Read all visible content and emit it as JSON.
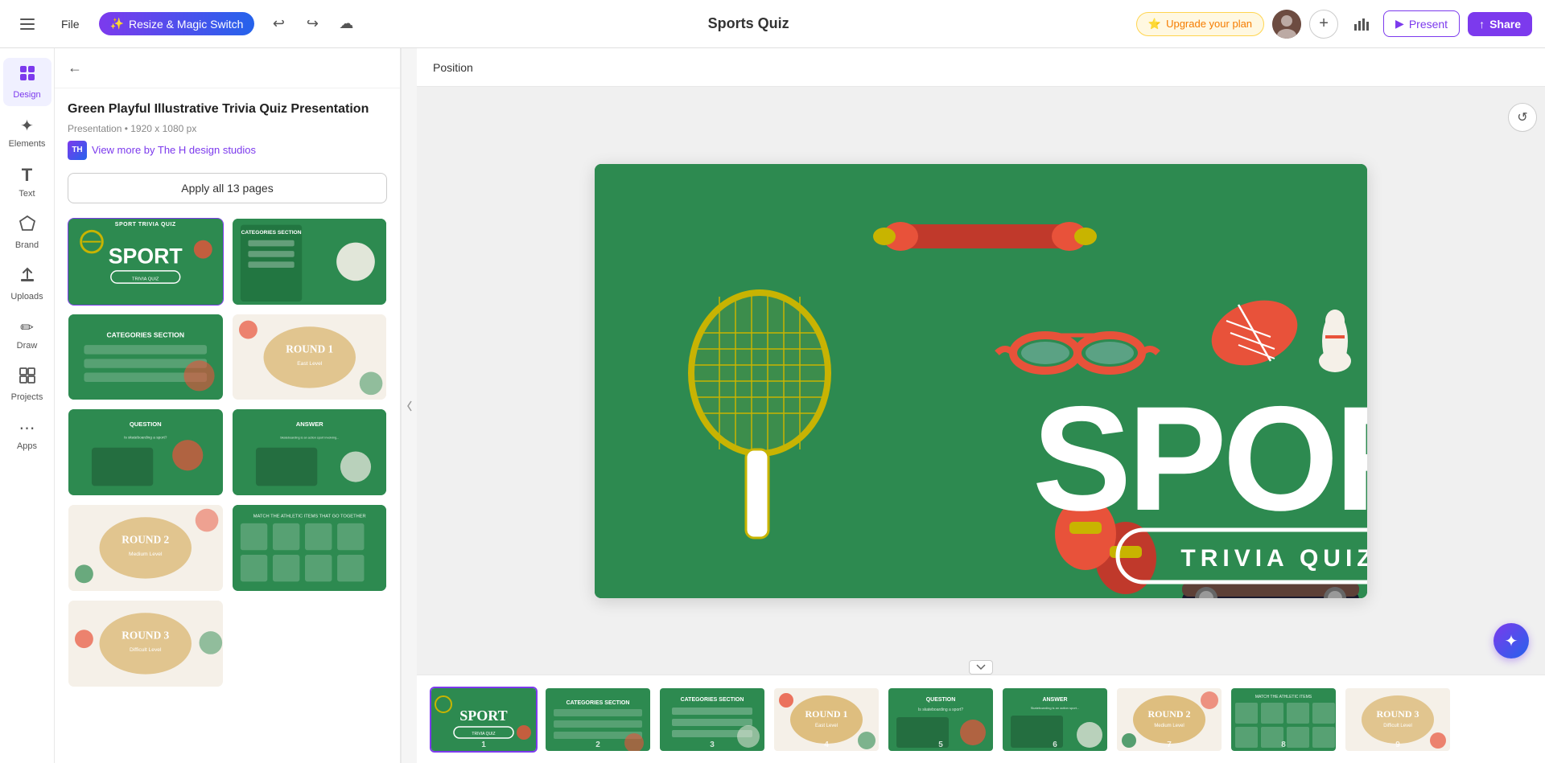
{
  "navbar": {
    "file_label": "File",
    "magic_switch_label": "Resize & Magic Switch",
    "doc_title": "Sports Quiz",
    "upgrade_label": "Upgrade your plan",
    "add_btn_label": "+",
    "present_label": "Present",
    "share_label": "Share"
  },
  "sidebar": {
    "items": [
      {
        "id": "design",
        "label": "Design",
        "icon": "⊞",
        "active": true
      },
      {
        "id": "elements",
        "label": "Elements",
        "icon": "✦"
      },
      {
        "id": "text",
        "label": "Text",
        "icon": "T"
      },
      {
        "id": "brand",
        "label": "Brand",
        "icon": "◈"
      },
      {
        "id": "uploads",
        "label": "Uploads",
        "icon": "↑"
      },
      {
        "id": "draw",
        "label": "Draw",
        "icon": "✏"
      },
      {
        "id": "projects",
        "label": "Projects",
        "icon": "▦"
      },
      {
        "id": "apps",
        "label": "Apps",
        "icon": "⋯"
      }
    ]
  },
  "panel": {
    "back_label": "←",
    "title": "Green Playful Illustrative Trivia Quiz Presentation",
    "meta": "Presentation • 1920 x 1080 px",
    "author_initials": "TH",
    "author_link": "View more by The H design studios",
    "apply_btn": "Apply all 13 pages",
    "position_label": "Position"
  },
  "thumbnails": [
    {
      "id": 1,
      "type": "sport",
      "label": "SPORT TRIVIA QUIZ",
      "bg": "#2d8a50"
    },
    {
      "id": 2,
      "type": "categories",
      "label": "CATEGORIES SECTION",
      "bg": "#2d8a50"
    },
    {
      "id": 3,
      "type": "categories2",
      "label": "CATEGORIES SECTION",
      "bg": "#2d8a50"
    },
    {
      "id": 4,
      "type": "round1",
      "label": "ROUND 1 EASY LEVEL",
      "bg": "#f5f0e8"
    },
    {
      "id": 5,
      "type": "question",
      "label": "QUESTION",
      "bg": "#2d8a50"
    },
    {
      "id": 6,
      "type": "answer",
      "label": "ANSWER",
      "bg": "#2d8a50"
    },
    {
      "id": 7,
      "type": "round2",
      "label": "ROUND 2 MEDIUM LEVEL",
      "bg": "#f5f0e8"
    },
    {
      "id": 8,
      "type": "match",
      "label": "MATCH THE ITEMS",
      "bg": "#2d8a50"
    },
    {
      "id": 9,
      "type": "round3",
      "label": "ROUND 3 DIFFICULT LEVEL",
      "bg": "#f5f0e8"
    }
  ],
  "filmstrip": [
    {
      "id": 1,
      "num": "1",
      "type": "sport",
      "bg": "#2d8a50",
      "active": true
    },
    {
      "id": 2,
      "num": "2",
      "type": "categories",
      "bg": "#2d8a50"
    },
    {
      "id": 3,
      "num": "3",
      "type": "categories2",
      "bg": "#2d8a50"
    },
    {
      "id": 4,
      "num": "4",
      "type": "round1",
      "bg": "#f5f0e8"
    },
    {
      "id": 5,
      "num": "5",
      "type": "question",
      "bg": "#2d8a50"
    },
    {
      "id": 6,
      "num": "6",
      "type": "answer",
      "bg": "#2d8a50"
    },
    {
      "id": 7,
      "num": "7",
      "type": "round2",
      "bg": "#f5f0e8"
    },
    {
      "id": 8,
      "num": "8",
      "type": "match",
      "bg": "#2d8a50"
    },
    {
      "id": 9,
      "num": "9",
      "type": "sport2",
      "bg": "#f5f0e8"
    }
  ],
  "main_slide": {
    "title": "SPORT",
    "subtitle": "TRIVIA QUIZ"
  }
}
